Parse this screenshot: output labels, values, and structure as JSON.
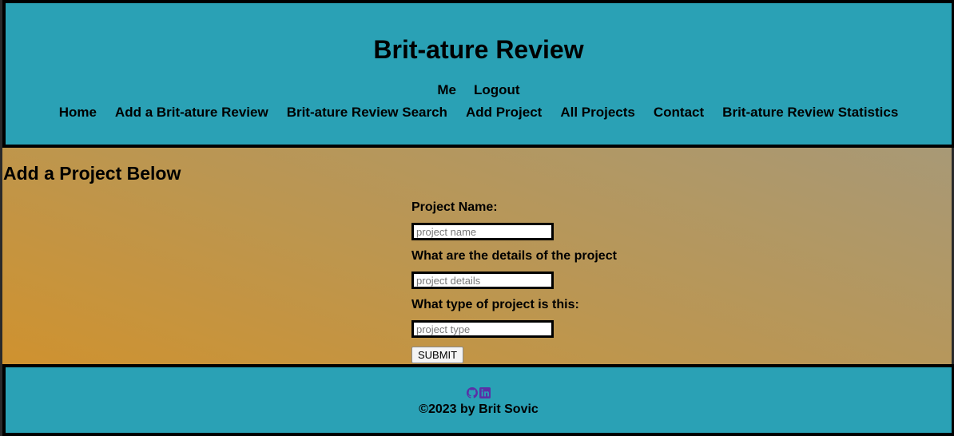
{
  "header": {
    "title": "Brit-ature Review",
    "user_nav": [
      {
        "label": "Me"
      },
      {
        "label": "Logout"
      }
    ],
    "main_nav": [
      {
        "label": "Home"
      },
      {
        "label": "Add a Brit-ature Review"
      },
      {
        "label": "Brit-ature Review Search"
      },
      {
        "label": "Add Project"
      },
      {
        "label": "All Projects"
      },
      {
        "label": "Contact"
      },
      {
        "label": "Brit-ature Review Statistics"
      }
    ]
  },
  "main": {
    "heading": "Add a Project Below",
    "form": {
      "fields": [
        {
          "label": "Project Name:",
          "placeholder": "project name",
          "value": ""
        },
        {
          "label": "What are the details of the project",
          "placeholder": "project details",
          "value": ""
        },
        {
          "label": "What type of project is this:",
          "placeholder": "project type",
          "value": ""
        }
      ],
      "submit_label": "SUBMIT"
    }
  },
  "footer": {
    "social_icons": [
      "github-icon",
      "linkedin-icon"
    ],
    "icon_color": "#5b2fa6",
    "copyright": "©2023 by Brit Sovic"
  },
  "colors": {
    "header_bg": "#2aa1b5",
    "border": "#000000",
    "gradient_start": "#cf922f",
    "gradient_end": "#a89976"
  }
}
